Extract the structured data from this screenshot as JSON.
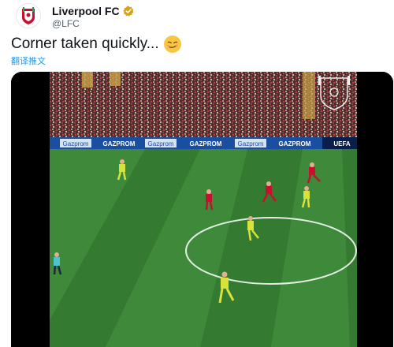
{
  "account": {
    "display_name": "Liverpool FC",
    "handle": "@LFC",
    "verified_icon": "verified-badge-icon",
    "avatar_icon": "lfc-crest-icon"
  },
  "tweet": {
    "text": "Corner taken quickly...",
    "emoji": "smirking-face-icon",
    "translate_label": "翻译推文"
  },
  "video": {
    "ad_boards": [
      "Gazprom",
      "GAZPROM",
      "Gazprom",
      "GAZPROM",
      "Gazprom",
      "GAZPROM",
      "UEFA"
    ],
    "watermark": "lfc-crest-watermark",
    "colors": {
      "pitch_light": "#3f8a3a",
      "pitch_dark": "#357a31",
      "ad_board": "#1a4ea0",
      "liverpool_kit": "#c8102e",
      "barcelona_kit": "#d7e23a"
    }
  }
}
